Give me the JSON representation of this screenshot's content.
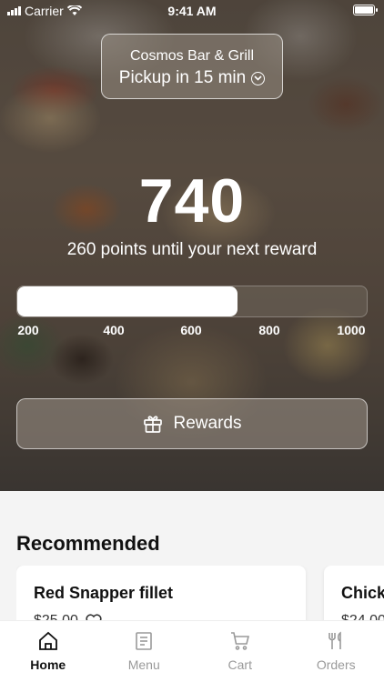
{
  "status_bar": {
    "carrier": "Carrier",
    "time": "9:41 AM"
  },
  "location": {
    "name": "Cosmos Bar & Grill",
    "pickup": "Pickup in 15 min"
  },
  "loyalty": {
    "points": "740",
    "until_next": "260 points until your next reward",
    "progress_fraction": 0.63,
    "ticks": [
      "200",
      "400",
      "600",
      "800",
      "1000"
    ]
  },
  "rewards_button": {
    "label": "Rewards",
    "icon": "gift-icon"
  },
  "recommended": {
    "title": "Recommended",
    "items": [
      {
        "name": "Red Snapper fillet",
        "price": "$25.00"
      },
      {
        "name": "Chick",
        "price": "$24.00"
      }
    ]
  },
  "tabs": [
    {
      "label": "Home",
      "icon": "home-icon",
      "active": true
    },
    {
      "label": "Menu",
      "icon": "menu-icon",
      "active": false
    },
    {
      "label": "Cart",
      "icon": "cart-icon",
      "active": false
    },
    {
      "label": "Orders",
      "icon": "utensils-icon",
      "active": false
    }
  ],
  "colors": {
    "active_tab": "#111111",
    "inactive_tab": "#9a9a9a",
    "page_bg": "#f4f4f4"
  }
}
